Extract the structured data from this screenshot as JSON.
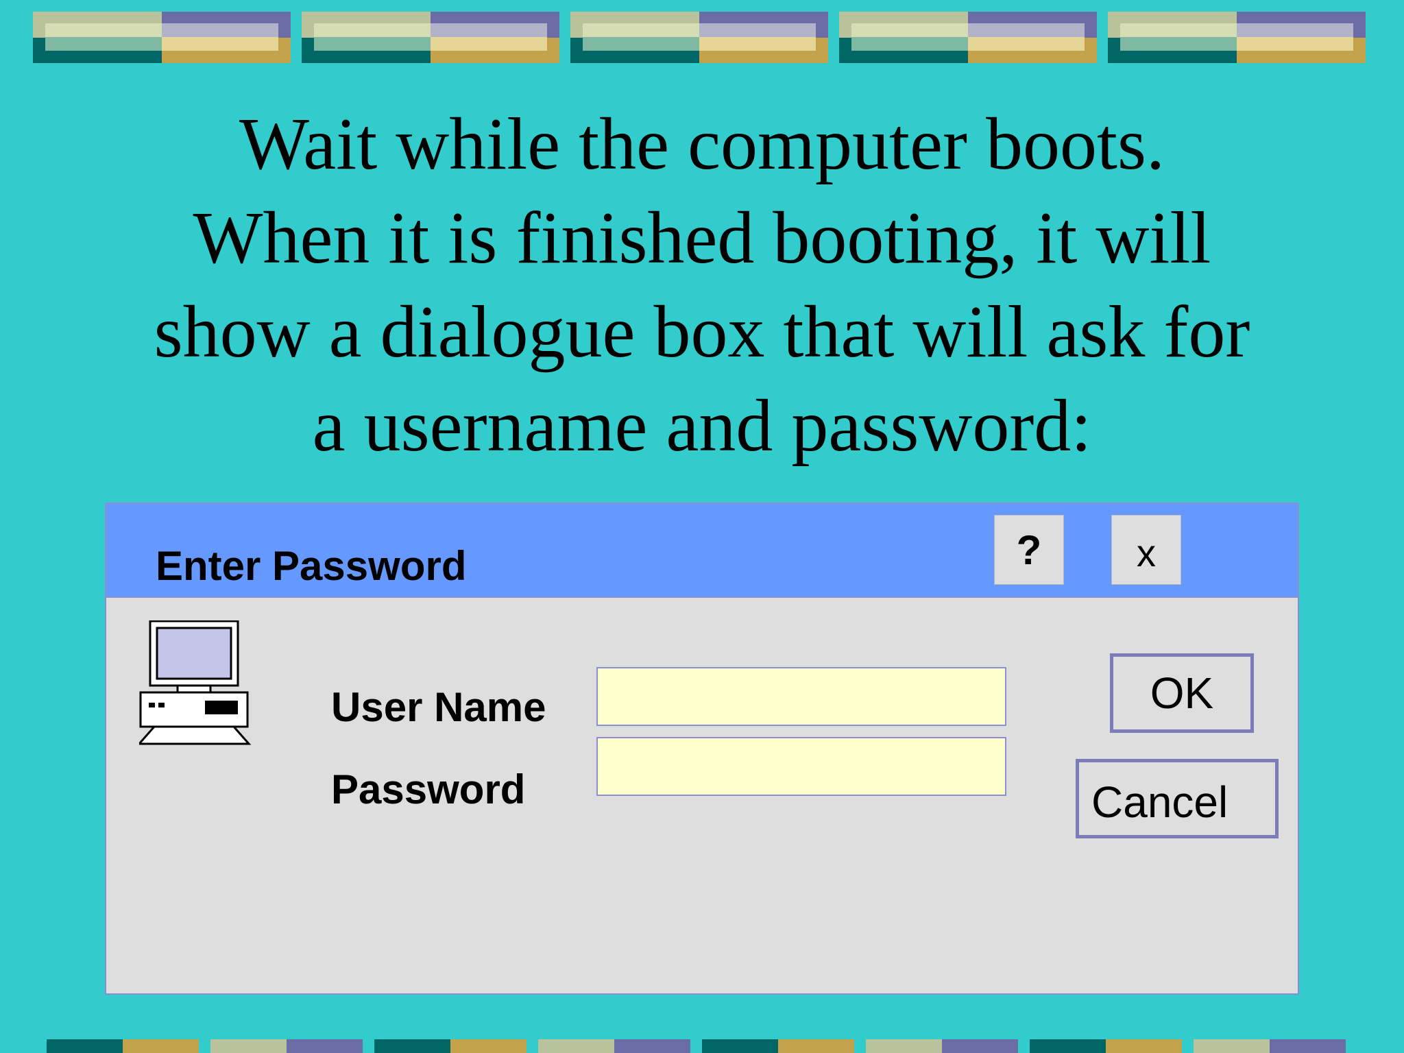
{
  "instruction": {
    "lines": [
      "Wait while the computer boots.",
      "When it is finished booting, it will",
      "show a dialogue box that will ask for",
      "a username and password:"
    ]
  },
  "dialog": {
    "title": "Enter Password",
    "help_button": "?",
    "close_button": "x",
    "icon": "computer-icon",
    "fields": {
      "username": {
        "label": "User Name",
        "value": "",
        "placeholder": ""
      },
      "password": {
        "label": "Password",
        "value": "",
        "placeholder": ""
      }
    },
    "ok_button": "OK",
    "cancel_button": "Cancel"
  },
  "colors": {
    "background": "#33CCCC",
    "title_bar": "#6699FF",
    "dialog_body": "#DEDEDE",
    "input_fill": "#FFFFCC",
    "button_border": "#7C7CB8",
    "border_teal": "#006666",
    "border_gold": "#C4A24C",
    "border_slate": "#6B6BA6",
    "border_sage": "#B9C29A"
  }
}
